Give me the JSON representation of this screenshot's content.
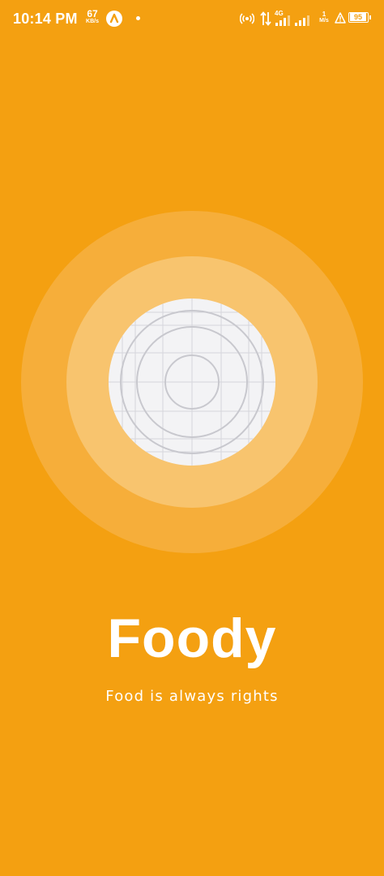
{
  "status_bar": {
    "time": "10:14 PM",
    "speed_value": "67",
    "speed_unit": "KB/s",
    "network_type": "4G",
    "data_rate_value": "1",
    "data_rate_unit": "M/s",
    "battery": "95",
    "icons": [
      "app-icon",
      "notification-dot-icon",
      "hotspot-icon",
      "data-transfer-icon",
      "signal-4g-icon",
      "signal-icon",
      "alert-icon",
      "battery-icon"
    ]
  },
  "splash": {
    "title": "Foody",
    "tagline": "Food is always rights",
    "illustration": "image-placeholder-icon"
  },
  "colors": {
    "background": "#F4A011",
    "ring_outer": "#F6AE3A",
    "ring_middle": "#F8C46E",
    "placeholder": "#F3F3F5",
    "text": "#FFFFFF"
  }
}
